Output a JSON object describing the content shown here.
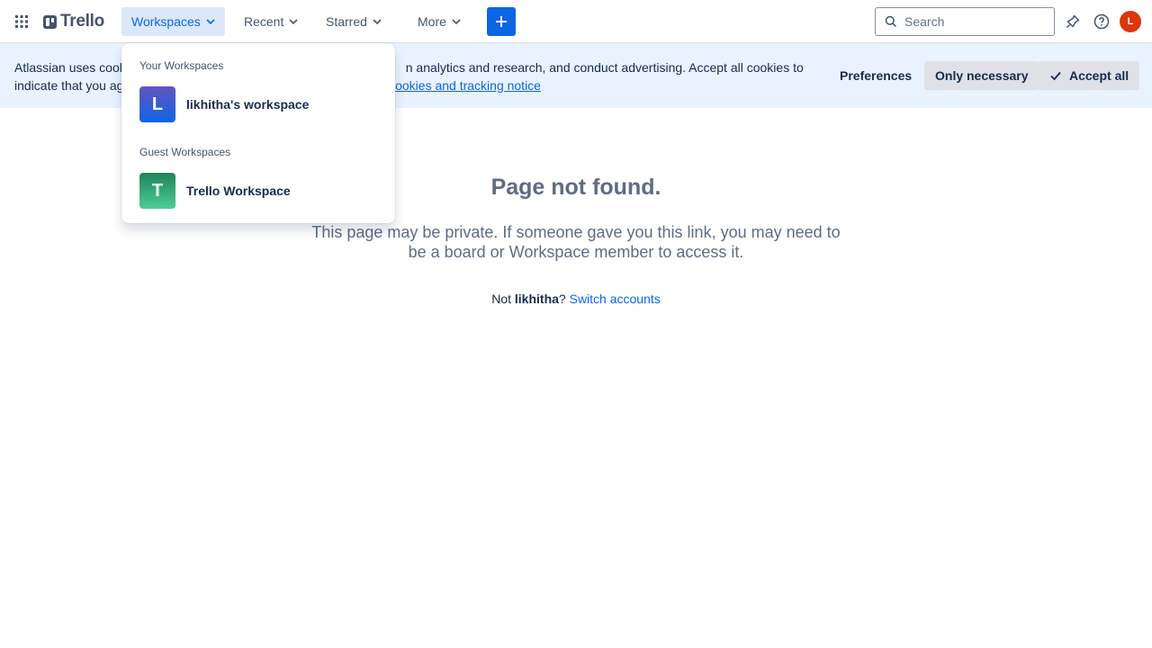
{
  "header": {
    "logo_text": "Trello",
    "nav": [
      {
        "label": "Workspaces",
        "active": true
      },
      {
        "label": "Recent",
        "active": false
      },
      {
        "label": "Starred",
        "active": false
      },
      {
        "label": "More",
        "active": false
      }
    ],
    "create_icon": "plus-icon",
    "search_placeholder": "Search",
    "icons": [
      "apps-grid-icon",
      "notifications-icon",
      "help-icon"
    ],
    "avatar_initial": "L",
    "colors": {
      "accent": "#0c66e4",
      "avatar": "#de350b"
    }
  },
  "cookie_banner": {
    "text_part1": "Atlassian uses cook",
    "text_part1b": "n analytics and research, and conduct advertising. Accept all cookies to",
    "text_part2": "indicate that you ag",
    "link_text": "n cookies and tracking notice",
    "preferences_label": "Preferences",
    "only_necessary_label": "Only necessary",
    "accept_all_label": "Accept all"
  },
  "dropdown": {
    "your_section_label": "Your Workspaces",
    "your_workspaces": [
      {
        "initial": "L",
        "name": "likhitha's workspace"
      }
    ],
    "guest_section_label": "Guest Workspaces",
    "guest_workspaces": [
      {
        "initial": "T",
        "name": "Trello Workspace"
      }
    ]
  },
  "main": {
    "title": "Page not found.",
    "message": "This page may be private. If someone gave you this link, you may need to be a board or Workspace member to access it.",
    "not_prefix": "Not ",
    "username": "likhitha",
    "question": "?",
    "switch_link": "Switch accounts"
  }
}
